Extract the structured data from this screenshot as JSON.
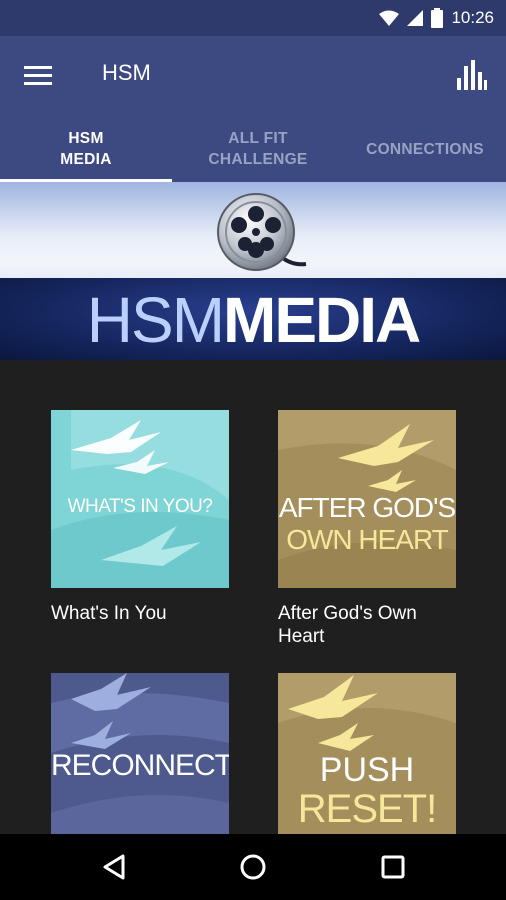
{
  "status_bar": {
    "time": "10:26",
    "icons": [
      "wifi-icon",
      "signal-icon",
      "battery-icon"
    ]
  },
  "app_bar": {
    "title": "HSM",
    "left_icon": "menu-icon",
    "right_icon": "bar-chart-icon"
  },
  "tabs": [
    {
      "line1": "HSM",
      "line2": "MEDIA",
      "active": true
    },
    {
      "line1": "ALL FIT",
      "line2": "CHALLENGE",
      "active": false
    },
    {
      "line1": "CONNECTIONS",
      "line2": "",
      "active": false
    }
  ],
  "banner": {
    "title_thin": "HSM",
    "title_bold": "MEDIA",
    "icon": "film-reel-icon"
  },
  "cards": [
    {
      "label": "What's In You",
      "thumb_text": "WHAT'S IN YOU?",
      "thumb_color": "#7fd4d6"
    },
    {
      "label": "After God's Own Heart",
      "thumb_line1": "AFTER GOD'S",
      "thumb_line2": "OWN HEART",
      "thumb_color": "#a48e5c"
    },
    {
      "label": "",
      "thumb_text": "RECONNECT",
      "thumb_color": "#4e5a8e"
    },
    {
      "label": "",
      "thumb_line1": "PUSH",
      "thumb_line2": "RESET!",
      "thumb_color": "#a48e5c"
    }
  ],
  "nav_bar": {
    "icons": [
      "back-icon",
      "home-icon",
      "recents-icon"
    ]
  },
  "colors": {
    "status_bar": "#2e3a6b",
    "app_bar": "#3d4a82",
    "content_bg": "#1f1f1f",
    "teal": "#7fd4d6",
    "gold": "#a48e5c",
    "slate": "#4e5a8e",
    "cream": "#f5e89a"
  }
}
